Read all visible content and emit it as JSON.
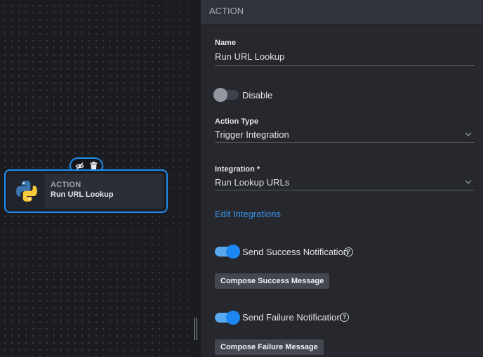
{
  "canvas": {
    "node": {
      "type_label": "ACTION",
      "name": "Run URL Lookup",
      "icon": "python-icon"
    },
    "toolbar": {
      "visibility_icon": "eye-off-icon",
      "delete_icon": "trash-icon"
    }
  },
  "panel": {
    "header": "ACTION",
    "name_label": "Name",
    "name_value": "Run URL Lookup",
    "disable_label": "Disable",
    "disable_on": false,
    "action_type_label": "Action Type",
    "action_type_value": "Trigger Integration",
    "integration_label": "Integration *",
    "integration_value": "Run Lookup URLs",
    "edit_integrations": "Edit Integrations",
    "success_label": "Send Success Notification",
    "success_on": true,
    "success_help": "?",
    "compose_success": "Compose Success Message",
    "failure_label": "Send Failure Notification",
    "failure_on": true,
    "failure_help": "?",
    "compose_failure": "Compose Failure Message"
  },
  "colors": {
    "accent": "#1d8df1",
    "link": "#3b95f1",
    "panel_bg": "#26282e",
    "canvas_bg": "#1b1c20"
  }
}
